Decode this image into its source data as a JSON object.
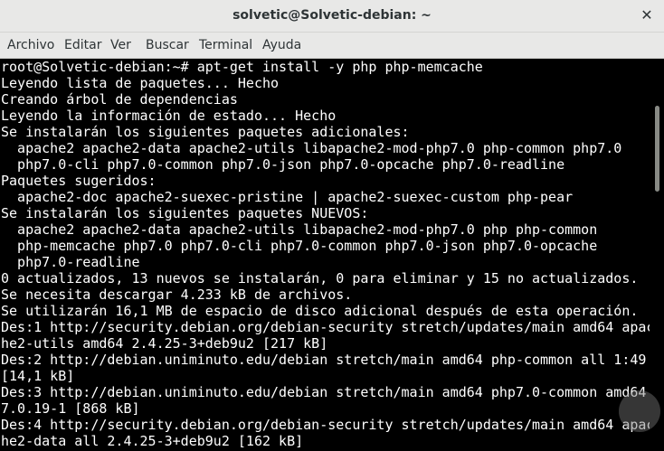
{
  "window": {
    "title": "solvetic@Solvetic-debian: ~",
    "close_symbol": "✕"
  },
  "menu": [
    {
      "label": "Archivo"
    },
    {
      "label": "Editar"
    },
    {
      "label": "Ver"
    },
    {
      "label": "Buscar"
    },
    {
      "label": "Terminal"
    },
    {
      "label": "Ayuda"
    }
  ],
  "terminal": {
    "lines": [
      "root@Solvetic-debian:~# apt-get install -y php php-memcache",
      "Leyendo lista de paquetes... Hecho",
      "Creando árbol de dependencias",
      "Leyendo la información de estado... Hecho",
      "Se instalarán los siguientes paquetes adicionales:",
      "  apache2 apache2-data apache2-utils libapache2-mod-php7.0 php-common php7.0",
      "  php7.0-cli php7.0-common php7.0-json php7.0-opcache php7.0-readline",
      "Paquetes sugeridos:",
      "  apache2-doc apache2-suexec-pristine | apache2-suexec-custom php-pear",
      "Se instalarán los siguientes paquetes NUEVOS:",
      "  apache2 apache2-data apache2-utils libapache2-mod-php7.0 php php-common",
      "  php-memcache php7.0 php7.0-cli php7.0-common php7.0-json php7.0-opcache",
      "  php7.0-readline",
      "0 actualizados, 13 nuevos se instalarán, 0 para eliminar y 15 no actualizados.",
      "Se necesita descargar 4.233 kB de archivos.",
      "Se utilizarán 16,1 MB de espacio de disco adicional después de esta operación.",
      "Des:1 http://security.debian.org/debian-security stretch/updates/main amd64 apac",
      "he2-utils amd64 2.4.25-3+deb9u2 [217 kB]",
      "Des:2 http://debian.uniminuto.edu/debian stretch/main amd64 php-common all 1:49",
      "[14,1 kB]",
      "Des:3 http://debian.uniminuto.edu/debian stretch/main amd64 php7.0-common amd64",
      "7.0.19-1 [868 kB]",
      "Des:4 http://security.debian.org/debian-security stretch/updates/main amd64 apac",
      "he2-data all 2.4.25-3+deb9u2 [162 kB]"
    ]
  },
  "colors": {
    "terminal_bg": "#000000",
    "terminal_fg": "#ffffff",
    "chrome_bg": "#e8e8e7"
  }
}
